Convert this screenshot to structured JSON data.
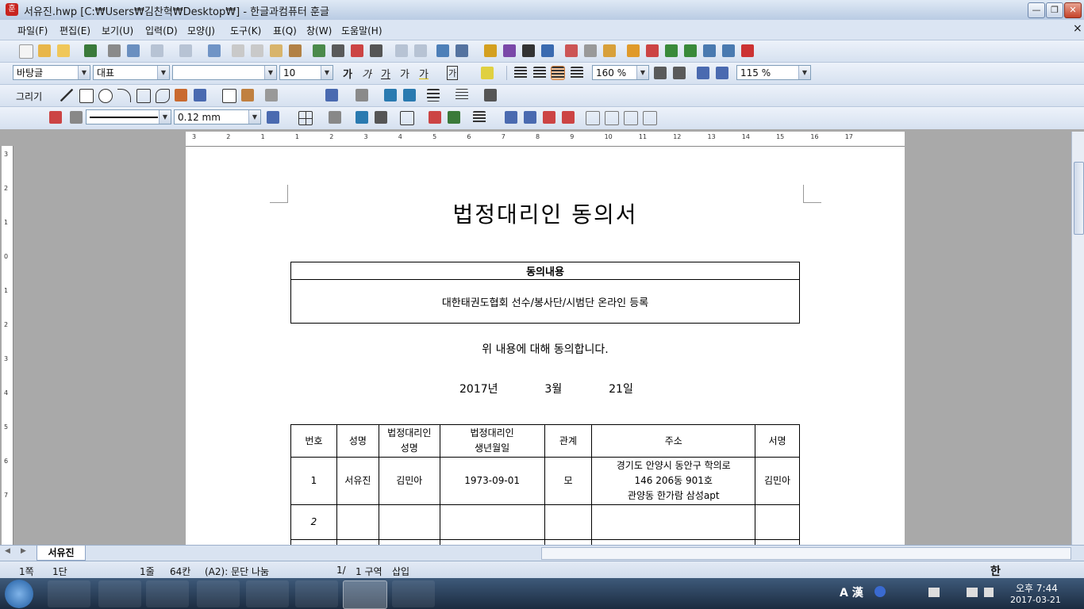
{
  "window": {
    "title": "서유진.hwp [C:₩Users₩김찬혁₩Desktop₩] - 한글과컴퓨터 훈글",
    "app_icon": "훈",
    "controls": {
      "minimize": "—",
      "restore": "❐",
      "close": "✕"
    }
  },
  "menu": [
    "파일(F)",
    "편집(E)",
    "보기(U)",
    "입력(D)",
    "모양(J)",
    "도구(K)",
    "표(Q)",
    "창(W)",
    "도움말(H)"
  ],
  "menu_close": "×",
  "format_bar": {
    "style": "바탕글",
    "font_lang": "대표",
    "font_name": "",
    "font_size": "10",
    "bold": "가",
    "italic": "가",
    "underline": "가",
    "strike": "가",
    "color_text": "가",
    "outline": "가",
    "line_spacing": "160 %",
    "zoom": "115 %"
  },
  "draw_bar": {
    "label": "그리기",
    "line_width": "0.12 mm"
  },
  "ruler": {
    "h_marks": [
      "3",
      "2",
      "1",
      "1",
      "2",
      "3",
      "4",
      "5",
      "6",
      "7",
      "8",
      "9",
      "10",
      "11",
      "12",
      "13",
      "14",
      "15",
      "16",
      "17"
    ],
    "v_marks": [
      "3",
      "2",
      "1",
      "0",
      "1",
      "2",
      "3",
      "4",
      "5",
      "6",
      "7"
    ]
  },
  "document": {
    "title": "법정대리인 동의서",
    "consent_header": "동의내용",
    "consent_body": "대한태권도협회 선수/봉사단/시범단 온라인 등록",
    "statement": "위 내용에 대해 동의합니다.",
    "date": {
      "year": "2017년",
      "month": "3월",
      "day": "21일"
    },
    "table": {
      "headers": [
        "번호",
        "성명",
        "법정대리인\n성명",
        "법정대리인\n생년월일",
        "관계",
        "주소",
        "서명"
      ],
      "rows": [
        [
          "1",
          "서유진",
          "김민아",
          "1973-09-01",
          "모",
          "경기도 안양시 동안구 학의로\n146 206동 901호\n관양동 한가람 삼성apt",
          "김민아"
        ],
        [
          "2",
          "",
          "",
          "",
          "",
          "",
          ""
        ]
      ]
    }
  },
  "sheet_tab": "서유진",
  "status": {
    "page": "1쪽",
    "column": "1단",
    "line": "1줄",
    "char": "64칸",
    "style_info": "(A2): 문단 나눔",
    "section_page": "1/",
    "section": "1 구역",
    "insert_mode": "삽입",
    "ime": "한"
  },
  "taskbar": {
    "time": "오후 7:44",
    "date": "2017-03-21",
    "lang": "A 漢"
  },
  "colors": {
    "accent": "#dbe5f3",
    "taskbar": "#1b2b40"
  }
}
